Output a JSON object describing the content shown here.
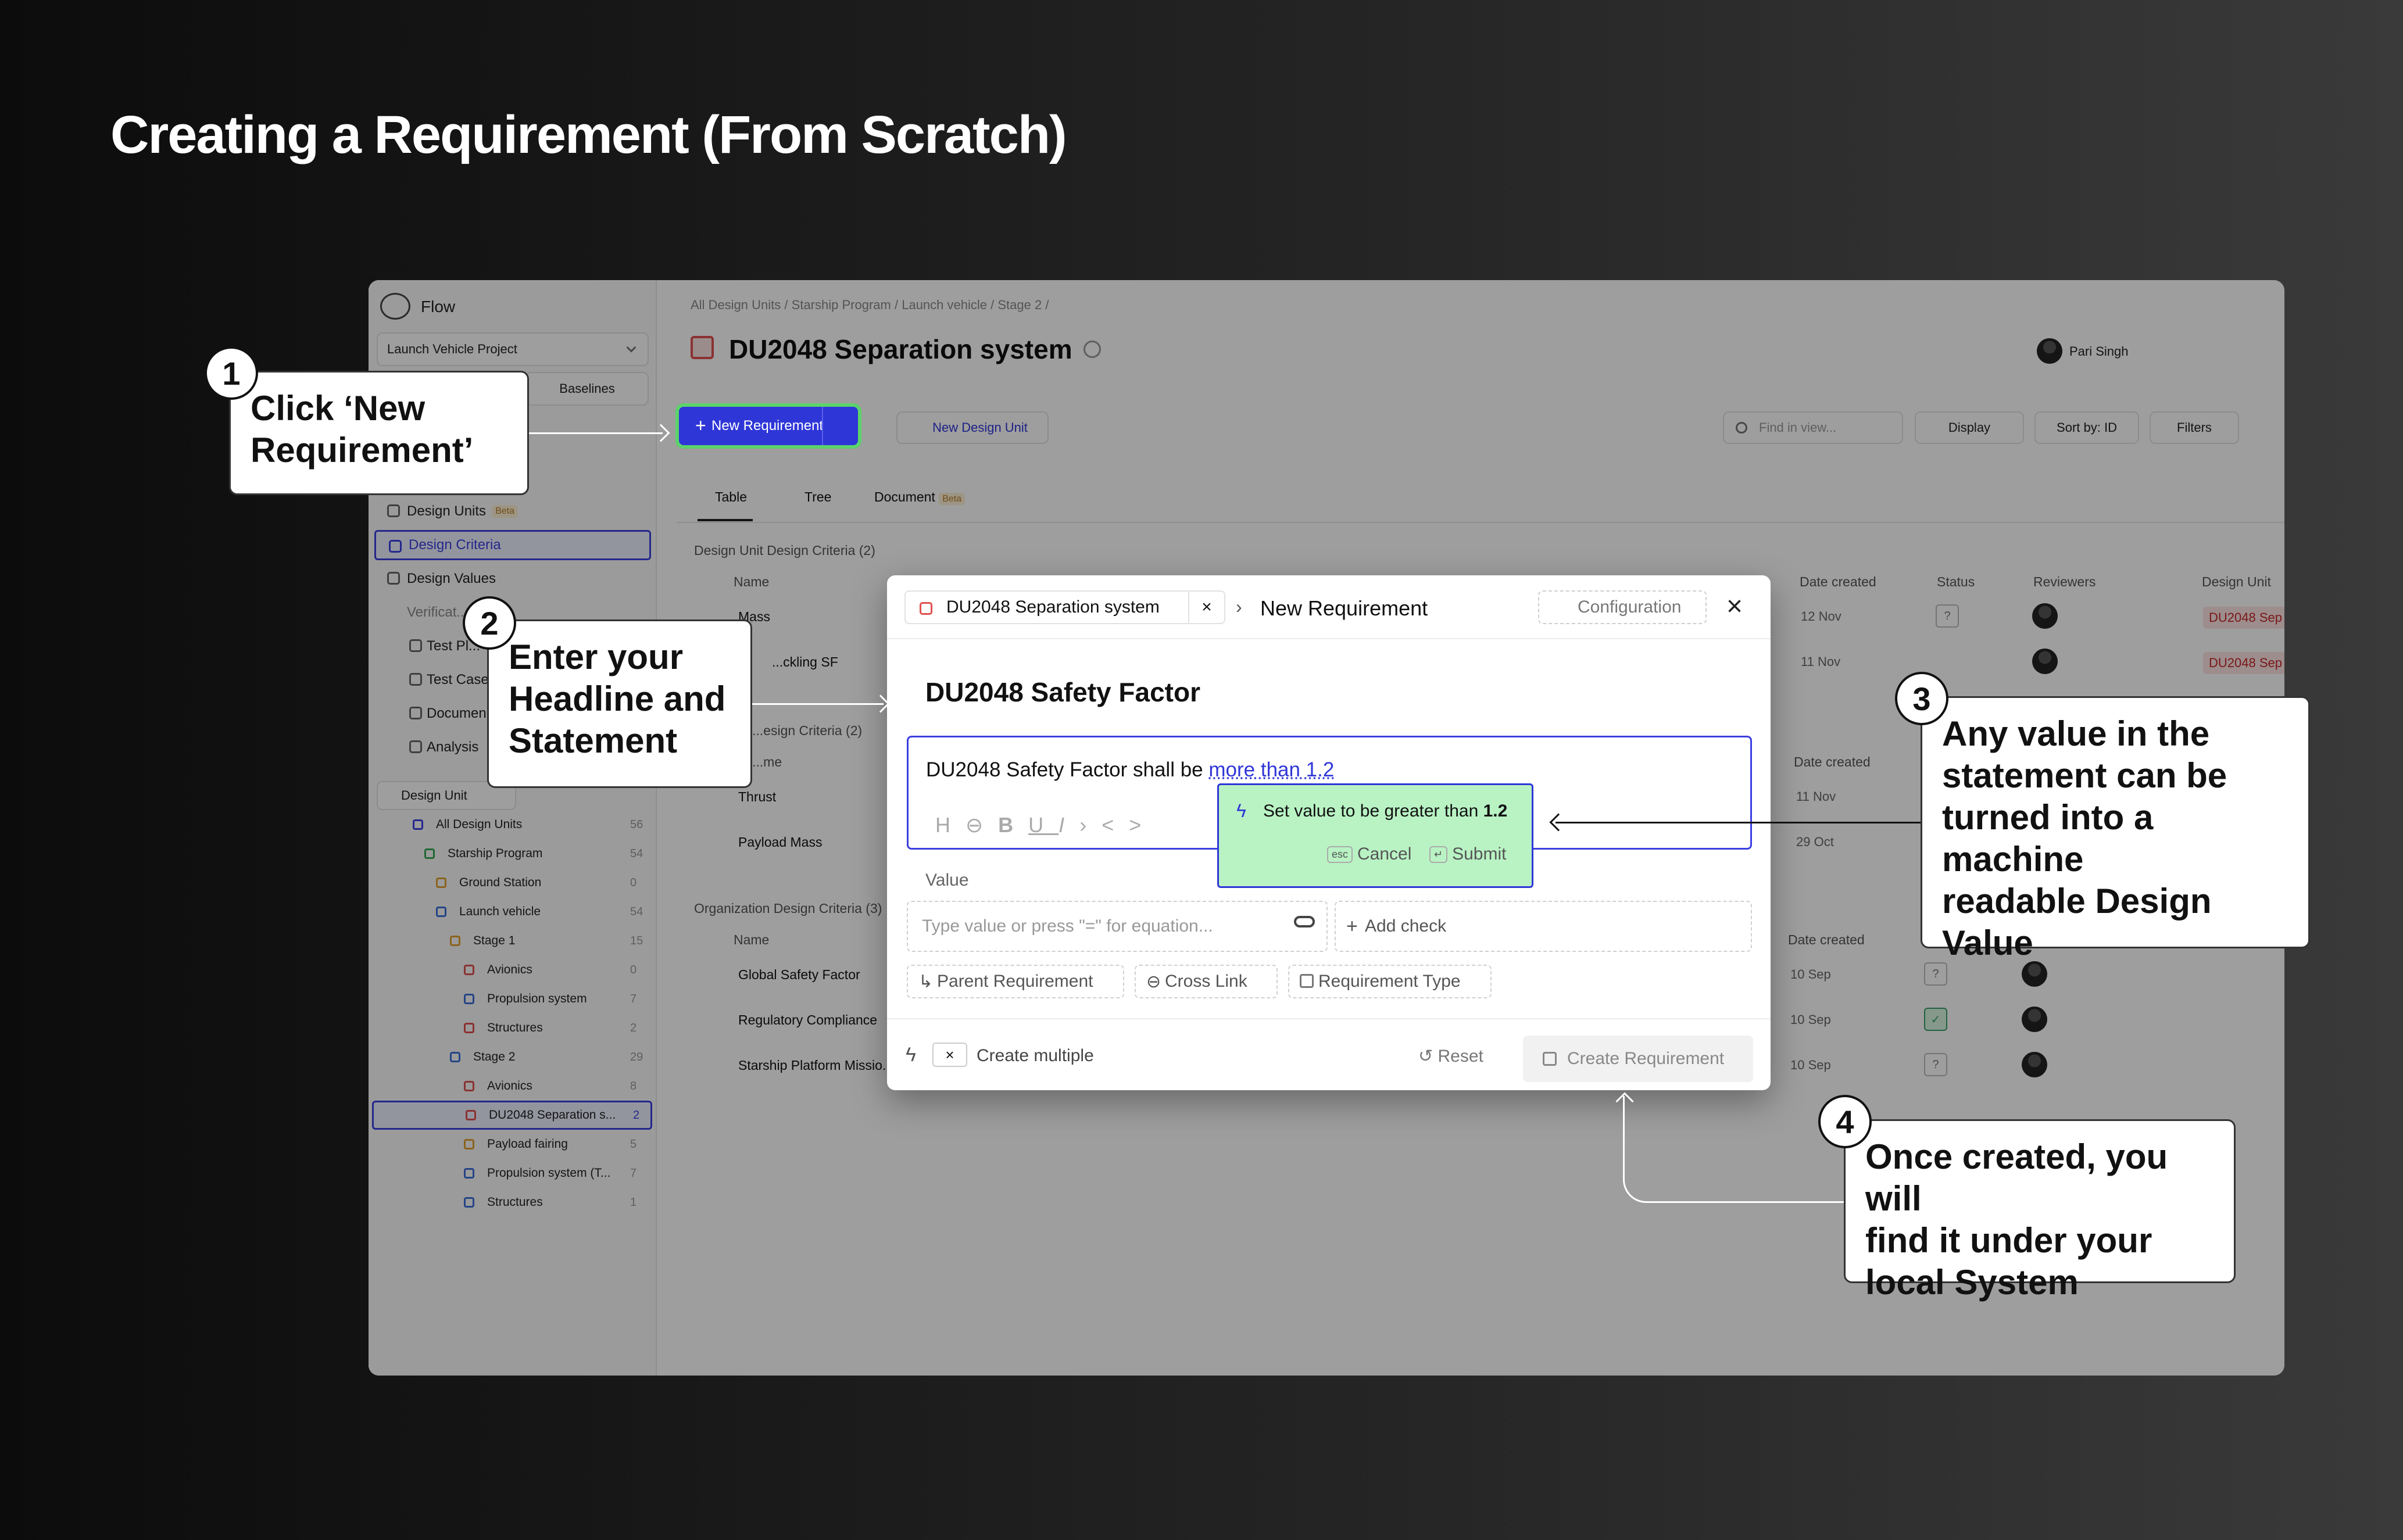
{
  "page_title": "Creating a Requirement (From Scratch)",
  "app": {
    "name": "Flow",
    "project": "Launch Vehicle Project",
    "baselines": "Baselines",
    "user": "Pari Singh"
  },
  "sidebar": {
    "nav": [
      {
        "label": "Design Units",
        "badge": "Beta"
      },
      {
        "label": "Design Criteria"
      },
      {
        "label": "Design Values"
      },
      {
        "label": "Verificat..."
      },
      {
        "label": "Test Pl..."
      },
      {
        "label": "Test Case..."
      },
      {
        "label": "Documen..."
      },
      {
        "label": "Analysis"
      }
    ],
    "design_unit_filter": "Design Unit",
    "tree": [
      {
        "label": "All Design Units",
        "count": "56"
      },
      {
        "label": "Starship Program",
        "count": "54"
      },
      {
        "label": "Ground Station",
        "count": "0"
      },
      {
        "label": "Launch vehicle",
        "count": "54"
      },
      {
        "label": "Stage 1",
        "count": "15"
      },
      {
        "label": "Avionics",
        "count": "0"
      },
      {
        "label": "Propulsion system",
        "count": "7"
      },
      {
        "label": "Structures",
        "count": "2"
      },
      {
        "label": "Stage 2",
        "count": "29"
      },
      {
        "label": "Avionics",
        "count": "8"
      },
      {
        "label": "DU2048 Separation s...",
        "count": "2"
      },
      {
        "label": "Payload fairing",
        "count": "5"
      },
      {
        "label": "Propulsion system (T...",
        "count": "7"
      },
      {
        "label": "Structures",
        "count": "1"
      }
    ]
  },
  "breadcrumb": [
    "All Design Units",
    "/",
    "Starship Program",
    "/",
    "Launch vehicle",
    "/",
    "Stage 2",
    "/"
  ],
  "main": {
    "title": "DU2048 Separation system",
    "new_requirement": "New Requirement",
    "new_design_unit": "New Design Unit",
    "search_placeholder": "Find in view...",
    "display": "Display",
    "sort": "Sort by: ID",
    "filters": "Filters",
    "tabs": [
      {
        "label": "Table"
      },
      {
        "label": "Tree"
      },
      {
        "label": "Document",
        "badge": "Beta"
      }
    ],
    "groups": [
      {
        "label": "Design Unit Design Criteria (2)"
      },
      {
        "label": "...esign Criteria (2)"
      },
      {
        "label": "Organization Design Criteria (3)"
      }
    ],
    "columns": {
      "name": "Name",
      "date_created": "Date created",
      "status": "Status",
      "reviewers": "Reviewers",
      "design_unit": "Design Unit"
    },
    "rows_group1": [
      {
        "name": "Mass",
        "date": "12 Nov",
        "status": "?",
        "du": "DU2048 Sep"
      },
      {
        "name": "...ckling SF",
        "date": "11 Nov",
        "du": "DU2048 Sep"
      }
    ],
    "col_name_short": "...me",
    "rows_group2": [
      {
        "name": "Thrust",
        "date": "11 Nov"
      },
      {
        "name": "Payload Mass",
        "date": "29 Oct"
      }
    ],
    "rows_group3": [
      {
        "name": "Global Safety Factor",
        "date": "10 Sep",
        "status": "?"
      },
      {
        "name": "Regulatory Compliance",
        "date": "10 Sep",
        "status": "✓"
      },
      {
        "name": "Starship Platform Missio...",
        "date": "10 Sep",
        "status": "?"
      }
    ]
  },
  "modal": {
    "context_chip": "DU2048 Separation system",
    "breadcrumb_title": "New Requirement",
    "configuration": "Configuration",
    "headline": "DU2048 Safety Factor",
    "statement_prefix": "DU2048 Safety Factor shall be ",
    "statement_link": "more than 1.2",
    "popup_text": "Set value to be greater than ",
    "popup_value": "1.2",
    "popup_cancel_key": "esc",
    "popup_cancel": "Cancel",
    "popup_submit_key": "↵",
    "popup_submit": "Submit",
    "value_label": "Value",
    "value_placeholder": "Type value or press \"=\" for equation...",
    "add_check": "Add check",
    "parent_requirement": "Parent Requirement",
    "cross_link": "Cross Link",
    "requirement_type": "Requirement Type",
    "create_multiple": "Create multiple",
    "reset": "Reset",
    "create_requirement": "Create Requirement"
  },
  "callouts": [
    {
      "num": "1",
      "text_l1": "Click ‘New",
      "text_l2": "Requirement’"
    },
    {
      "num": "2",
      "text_l1": "Enter your",
      "text_l2": "Headline and",
      "text_l3": "Statement"
    },
    {
      "num": "3",
      "text_l1": "Any value in the",
      "text_l2": "statement can be",
      "text_l3": "turned into a machine",
      "text_l4": "readable Design",
      "text_l5": "Value"
    },
    {
      "num": "4",
      "text_l1": "Once created, you will",
      "text_l2": "find it under your",
      "text_l3": "local System"
    }
  ],
  "colors": {
    "accent": "#2f36d8",
    "highlight_green": "#b9f3c4",
    "red": "#c62828"
  }
}
